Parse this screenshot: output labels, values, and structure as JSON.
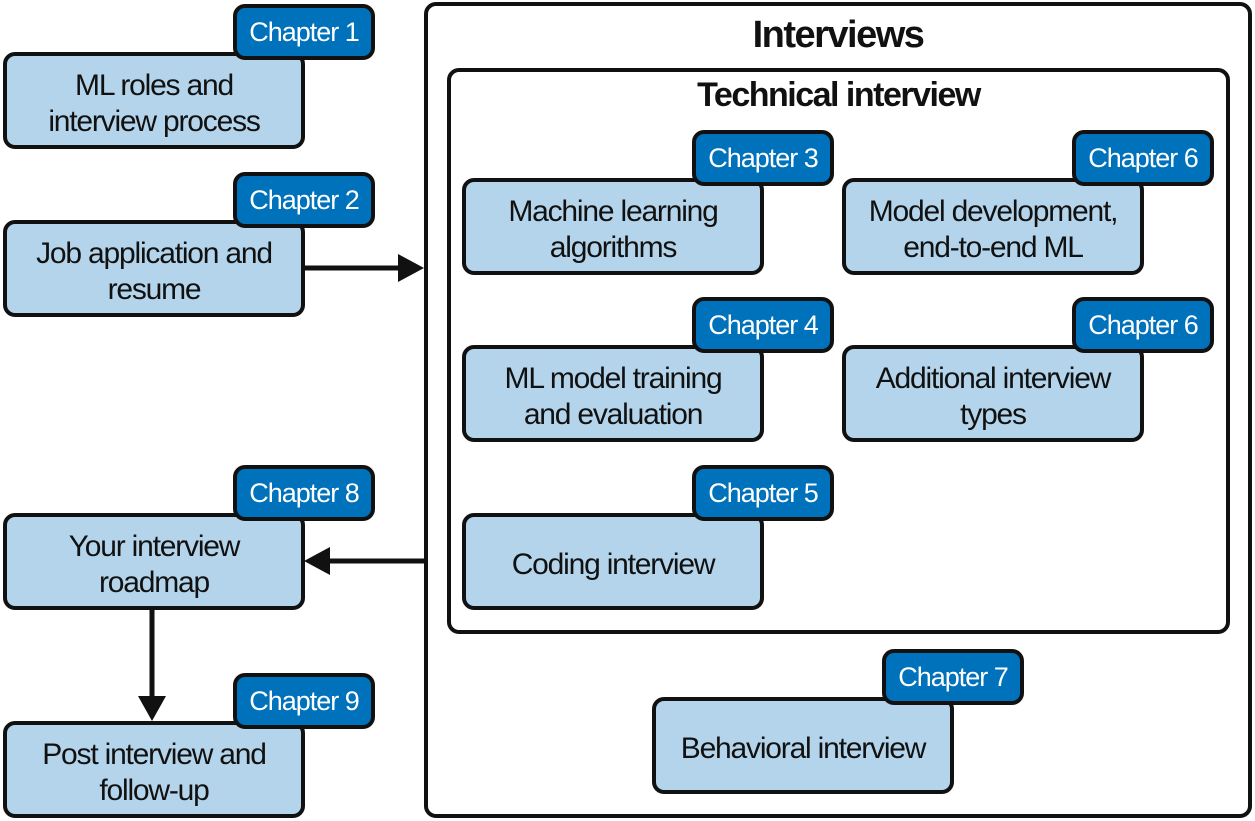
{
  "colors": {
    "box_fill": "#b3d4ea",
    "badge_fill": "#0071bb",
    "border": "#111111"
  },
  "interviews": {
    "title": "Interviews"
  },
  "technical": {
    "title": "Technical interview"
  },
  "nodes": [
    {
      "id": "ml-roles",
      "label": "ML roles and interview process",
      "chapter": "Chapter 1"
    },
    {
      "id": "job-application",
      "label": "Job application and resume",
      "chapter": "Chapter 2"
    },
    {
      "id": "ml-algorithms",
      "label": "Machine learning algorithms",
      "chapter": "Chapter 3"
    },
    {
      "id": "model-development",
      "label": "Model development, end-to-end ML",
      "chapter": "Chapter 6"
    },
    {
      "id": "model-training",
      "label": "ML model training and evaluation",
      "chapter": "Chapter 4"
    },
    {
      "id": "additional-types",
      "label": "Additional interview types",
      "chapter": "Chapter 6"
    },
    {
      "id": "coding",
      "label": "Coding interview",
      "chapter": "Chapter 5"
    },
    {
      "id": "roadmap",
      "label": "Your interview roadmap",
      "chapter": "Chapter 8"
    },
    {
      "id": "post-interview",
      "label": "Post interview and follow-up",
      "chapter": "Chapter 9"
    },
    {
      "id": "behavioral",
      "label": "Behavioral interview",
      "chapter": "Chapter 7"
    }
  ],
  "edges": [
    {
      "from": "job-application",
      "to": "interviews"
    },
    {
      "from": "interviews",
      "to": "roadmap"
    },
    {
      "from": "roadmap",
      "to": "post-interview"
    }
  ]
}
